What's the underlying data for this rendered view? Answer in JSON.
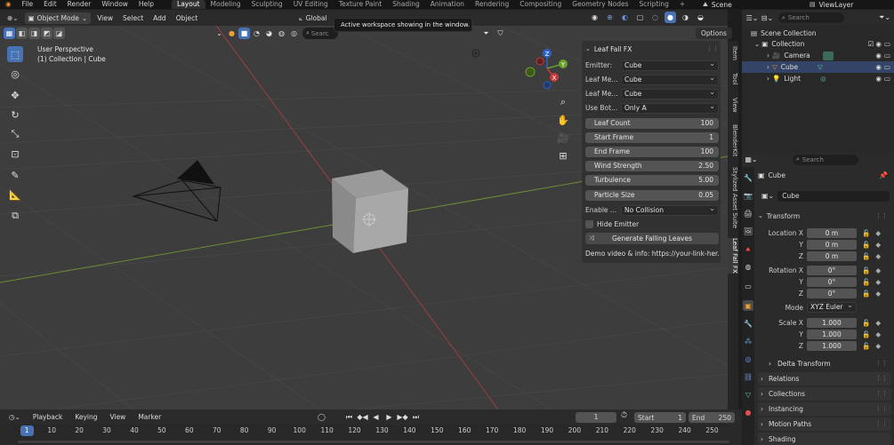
{
  "menu": [
    "File",
    "Edit",
    "Render",
    "Window",
    "Help"
  ],
  "workspaces": [
    "Layout",
    "Modeling",
    "Sculpting",
    "UV Editing",
    "Texture Paint",
    "Shading",
    "Animation",
    "Rendering",
    "Compositing",
    "Geometry Nodes",
    "Scripting"
  ],
  "workspace_add": "+",
  "scene": "Scene",
  "view_layer": "ViewLayer",
  "viewport": {
    "mode": "Object Mode",
    "menus": [
      "View",
      "Select",
      "Add",
      "Object"
    ],
    "transform_orientation": "Global",
    "search_placeholder": "Searc",
    "options_label": "Options",
    "perspective": "User Perspective",
    "collection_info": "(1) Collection | Cube",
    "tooltip": "Active workspace showing in the window."
  },
  "gizmo": {
    "x": "X",
    "y": "Y",
    "z": "Z"
  },
  "leaf_panel": {
    "title": "Leaf Fall FX",
    "emitter_label": "Emitter:",
    "emitter_value": "Cube",
    "leaf_mesh1_label": "Leaf Me...",
    "leaf_mesh1_value": "Cube",
    "leaf_mesh2_label": "Leaf Me...",
    "leaf_mesh2_value": "Cube",
    "use_bot_label": "Use Bot...",
    "use_bot_value": "Only A",
    "leaf_count_label": "Leaf Count",
    "leaf_count_value": "100",
    "start_frame_label": "Start Frame",
    "start_frame_value": "1",
    "end_frame_label": "End Frame",
    "end_frame_value": "100",
    "wind_label": "Wind Strength",
    "wind_value": "2.50",
    "turb_label": "Turbulence",
    "turb_value": "5.00",
    "psize_label": "Particle Size",
    "psize_value": "0.05",
    "enable_label": "Enable ...",
    "enable_value": "No Collision",
    "hide_emitter_label": "Hide Emitter",
    "generate_label": "Generate Falling Leaves",
    "demo_text": "Demo video & info: https://your-link-her..."
  },
  "side_tabs": [
    "Item",
    "Tool",
    "View",
    "BlenderKit",
    "Stylized Asset Suite",
    "Leaf Fall FX"
  ],
  "outliner": {
    "search_placeholder": "Search",
    "scene_collection": "Scene Collection",
    "collection": "Collection",
    "items": [
      "Camera",
      "Cube",
      "Light"
    ]
  },
  "properties": {
    "search_placeholder": "Search",
    "object_name": "Cube",
    "data_name": "Cube",
    "transform_label": "Transform",
    "location_label": "Location X",
    "loc_x": "0 m",
    "loc_y": "0 m",
    "loc_z": "0 m",
    "rotation_label": "Rotation X",
    "rot_x": "0°",
    "rot_y": "0°",
    "rot_z": "0°",
    "y_label": "Y",
    "z_label": "Z",
    "mode_label": "Mode",
    "mode_value": "XYZ Euler",
    "scale_label": "Scale X",
    "scale_x": "1.000",
    "scale_y": "1.000",
    "scale_z": "1.000",
    "sections": [
      "Delta Transform",
      "Relations",
      "Collections",
      "Instancing",
      "Motion Paths",
      "Shading"
    ]
  },
  "timeline": {
    "menus": [
      "Playback",
      "Keying",
      "View",
      "Marker"
    ],
    "current_frame": "1",
    "start_label": "Start",
    "start_value": "1",
    "end_label": "End",
    "end_value": "250",
    "ticks": [
      "1",
      "10",
      "20",
      "30",
      "40",
      "50",
      "60",
      "70",
      "80",
      "90",
      "100",
      "110",
      "120",
      "130",
      "140",
      "150",
      "160",
      "170",
      "180",
      "190",
      "200",
      "210",
      "220",
      "230",
      "240",
      "250"
    ]
  },
  "colors": {
    "accent": "#4772b3",
    "selected_orange": "#f5a623",
    "grid_red": "#b34444",
    "grid_green": "#6f9b3a"
  }
}
